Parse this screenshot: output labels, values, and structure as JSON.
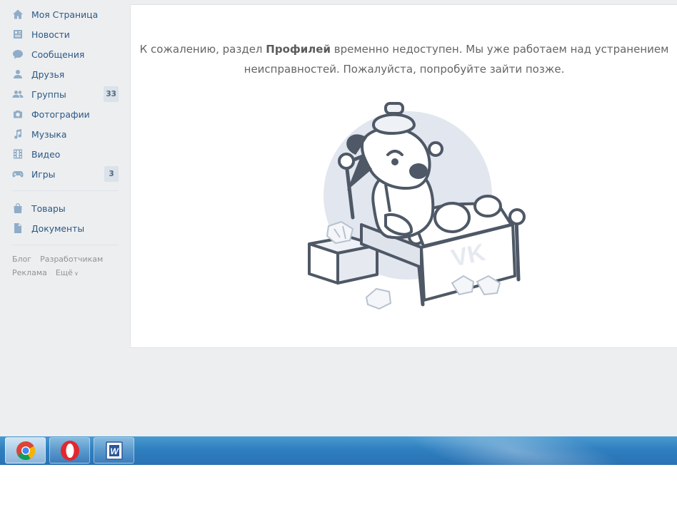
{
  "sidebar": {
    "items": [
      {
        "label": "Моя Страница",
        "icon": "home-icon"
      },
      {
        "label": "Новости",
        "icon": "news-icon"
      },
      {
        "label": "Сообщения",
        "icon": "messages-icon"
      },
      {
        "label": "Друзья",
        "icon": "friends-icon"
      },
      {
        "label": "Группы",
        "icon": "groups-icon",
        "badge": "33"
      },
      {
        "label": "Фотографии",
        "icon": "photo-icon"
      },
      {
        "label": "Музыка",
        "icon": "music-icon"
      },
      {
        "label": "Видео",
        "icon": "video-icon"
      },
      {
        "label": "Игры",
        "icon": "games-icon",
        "badge": "3"
      }
    ],
    "items2": [
      {
        "label": "Товары",
        "icon": "market-icon"
      },
      {
        "label": "Документы",
        "icon": "documents-icon"
      }
    ],
    "footer": {
      "blog": "Блог",
      "developers": "Разработчикам",
      "ads": "Реклама",
      "more": "Ещё"
    }
  },
  "main": {
    "message_pre": "К сожалению, раздел ",
    "message_bold": "Профилей",
    "message_post": " временно недоступен. Мы уже работаем над устранением неисправностей. Пожалуйста, попробуйте зайти позже.",
    "illustration_badge": "VK"
  },
  "taskbar": {
    "apps": [
      {
        "name": "chrome",
        "icon": "chrome-icon",
        "active": true
      },
      {
        "name": "opera",
        "icon": "opera-icon",
        "active": false
      },
      {
        "name": "word",
        "icon": "word-icon",
        "active": false
      }
    ]
  },
  "colors": {
    "link": "#2a5885",
    "icon": "#8fadc8",
    "background": "#edeef0",
    "badge_bg": "#dae2ea"
  }
}
